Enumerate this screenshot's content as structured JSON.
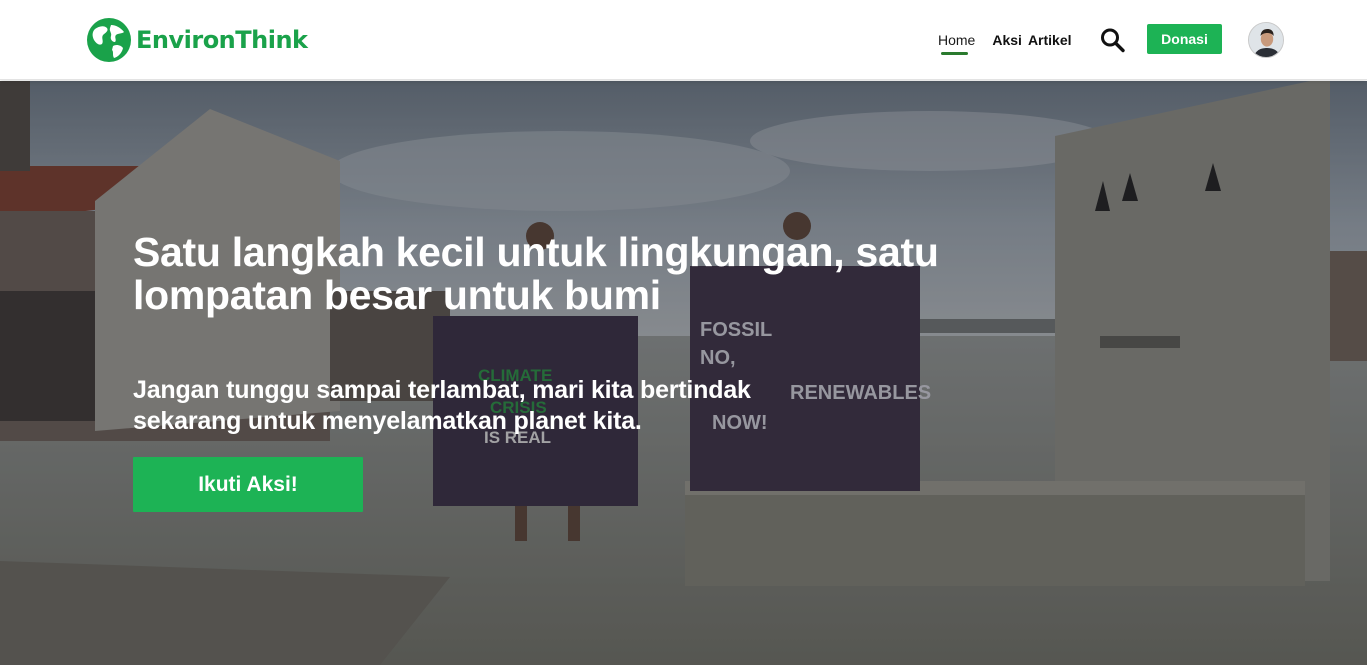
{
  "brand": {
    "name": "EnvironThink",
    "logo_icon": "globe-icon",
    "accent_color": "#1db355"
  },
  "nav": {
    "links": [
      {
        "label": "Home",
        "active": true
      },
      {
        "label": "Aksi",
        "active": false
      },
      {
        "label": "Artikel",
        "active": false
      }
    ],
    "search_icon": "search-icon",
    "donate_label": "Donasi",
    "avatar_icon": "user-avatar"
  },
  "hero": {
    "title": "Satu langkah kecil untuk lingkungan, satu lompatan besar untuk bumi",
    "subtitle": "Jangan tunggu sampai terlambat, mari kita bertindak sekarang untuk menyelamatkan planet kita.",
    "cta_label": "Ikuti Aksi!",
    "background": "photo-flooded-houses-protesters-with-banners",
    "banner_texts": [
      "CLIMATE",
      "CRISIS",
      "IS REAL",
      "FOSSIL",
      "NO,",
      "RENEWABLES",
      "NOW!"
    ]
  }
}
